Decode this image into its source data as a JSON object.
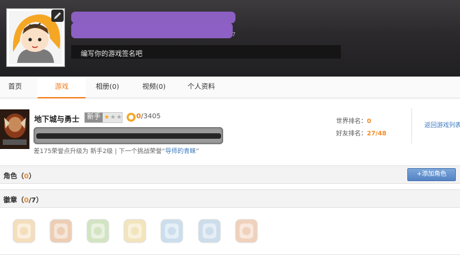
{
  "header": {
    "signature_placeholder": "编写你的游戏签名吧",
    "id_suffix": "7"
  },
  "tabs": [
    {
      "label": "首页"
    },
    {
      "label": "游戏"
    },
    {
      "label": "相册(0)"
    },
    {
      "label": "视频(0)"
    },
    {
      "label": "个人资料"
    }
  ],
  "game": {
    "title": "地下城与勇士",
    "rank_label": "新手",
    "stars_filled": 1,
    "stars_total": 3,
    "honor_current": "0",
    "honor_total": "/3405",
    "upgrade_prefix": "差175荣誉点升级为 新手2级 | 下一个挑战荣誉“",
    "next_title": "导师的青睐",
    "upgrade_suffix": "”",
    "world_rank_label": "世界排名：",
    "world_rank_value": "0",
    "friend_rank_label": "好友排名：",
    "friend_rank_value": "27/48",
    "back_link": "返回游戏列表"
  },
  "roles": {
    "label": "角色（",
    "count": "0",
    "suffix": "）",
    "add_button": "+添加角色"
  },
  "badges": {
    "label": "徽章（",
    "count": "0",
    "suffix": "/7）",
    "items": [
      {
        "name": "badge-1",
        "color": "#e8b86a"
      },
      {
        "name": "badge-2",
        "color": "#d9955a"
      },
      {
        "name": "badge-3",
        "color": "#9fc47a"
      },
      {
        "name": "badge-4",
        "color": "#e3c46c"
      },
      {
        "name": "badge-5",
        "color": "#8fb8d8"
      },
      {
        "name": "badge-6",
        "color": "#90b6d6"
      },
      {
        "name": "badge-7",
        "color": "#e09a6a"
      }
    ]
  },
  "colors": {
    "accent": "#f58220",
    "link": "#3a78c0",
    "redaction": "#8c5fc2"
  }
}
